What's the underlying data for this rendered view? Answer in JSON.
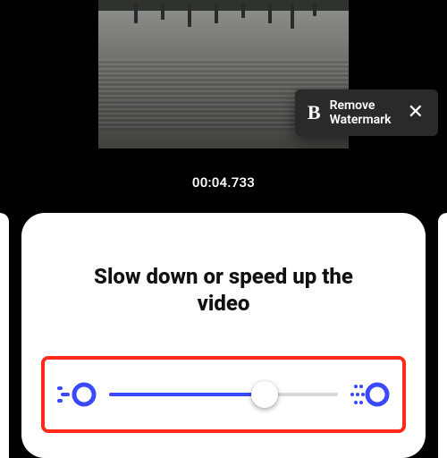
{
  "preview": {
    "timestamp": "00:04.733"
  },
  "watermark": {
    "logo_letter": "B",
    "line1": "Remove",
    "line2": "Watermark",
    "close_glyph": "✕"
  },
  "panel": {
    "title": "Slow down or speed up the video"
  },
  "slider": {
    "min": 0,
    "max": 100,
    "value": 68,
    "accent": "#3a49ff",
    "highlight_border": "#ff2a1a"
  },
  "icons": {
    "slow": "slow-speed-icon",
    "fast": "fast-speed-icon"
  }
}
